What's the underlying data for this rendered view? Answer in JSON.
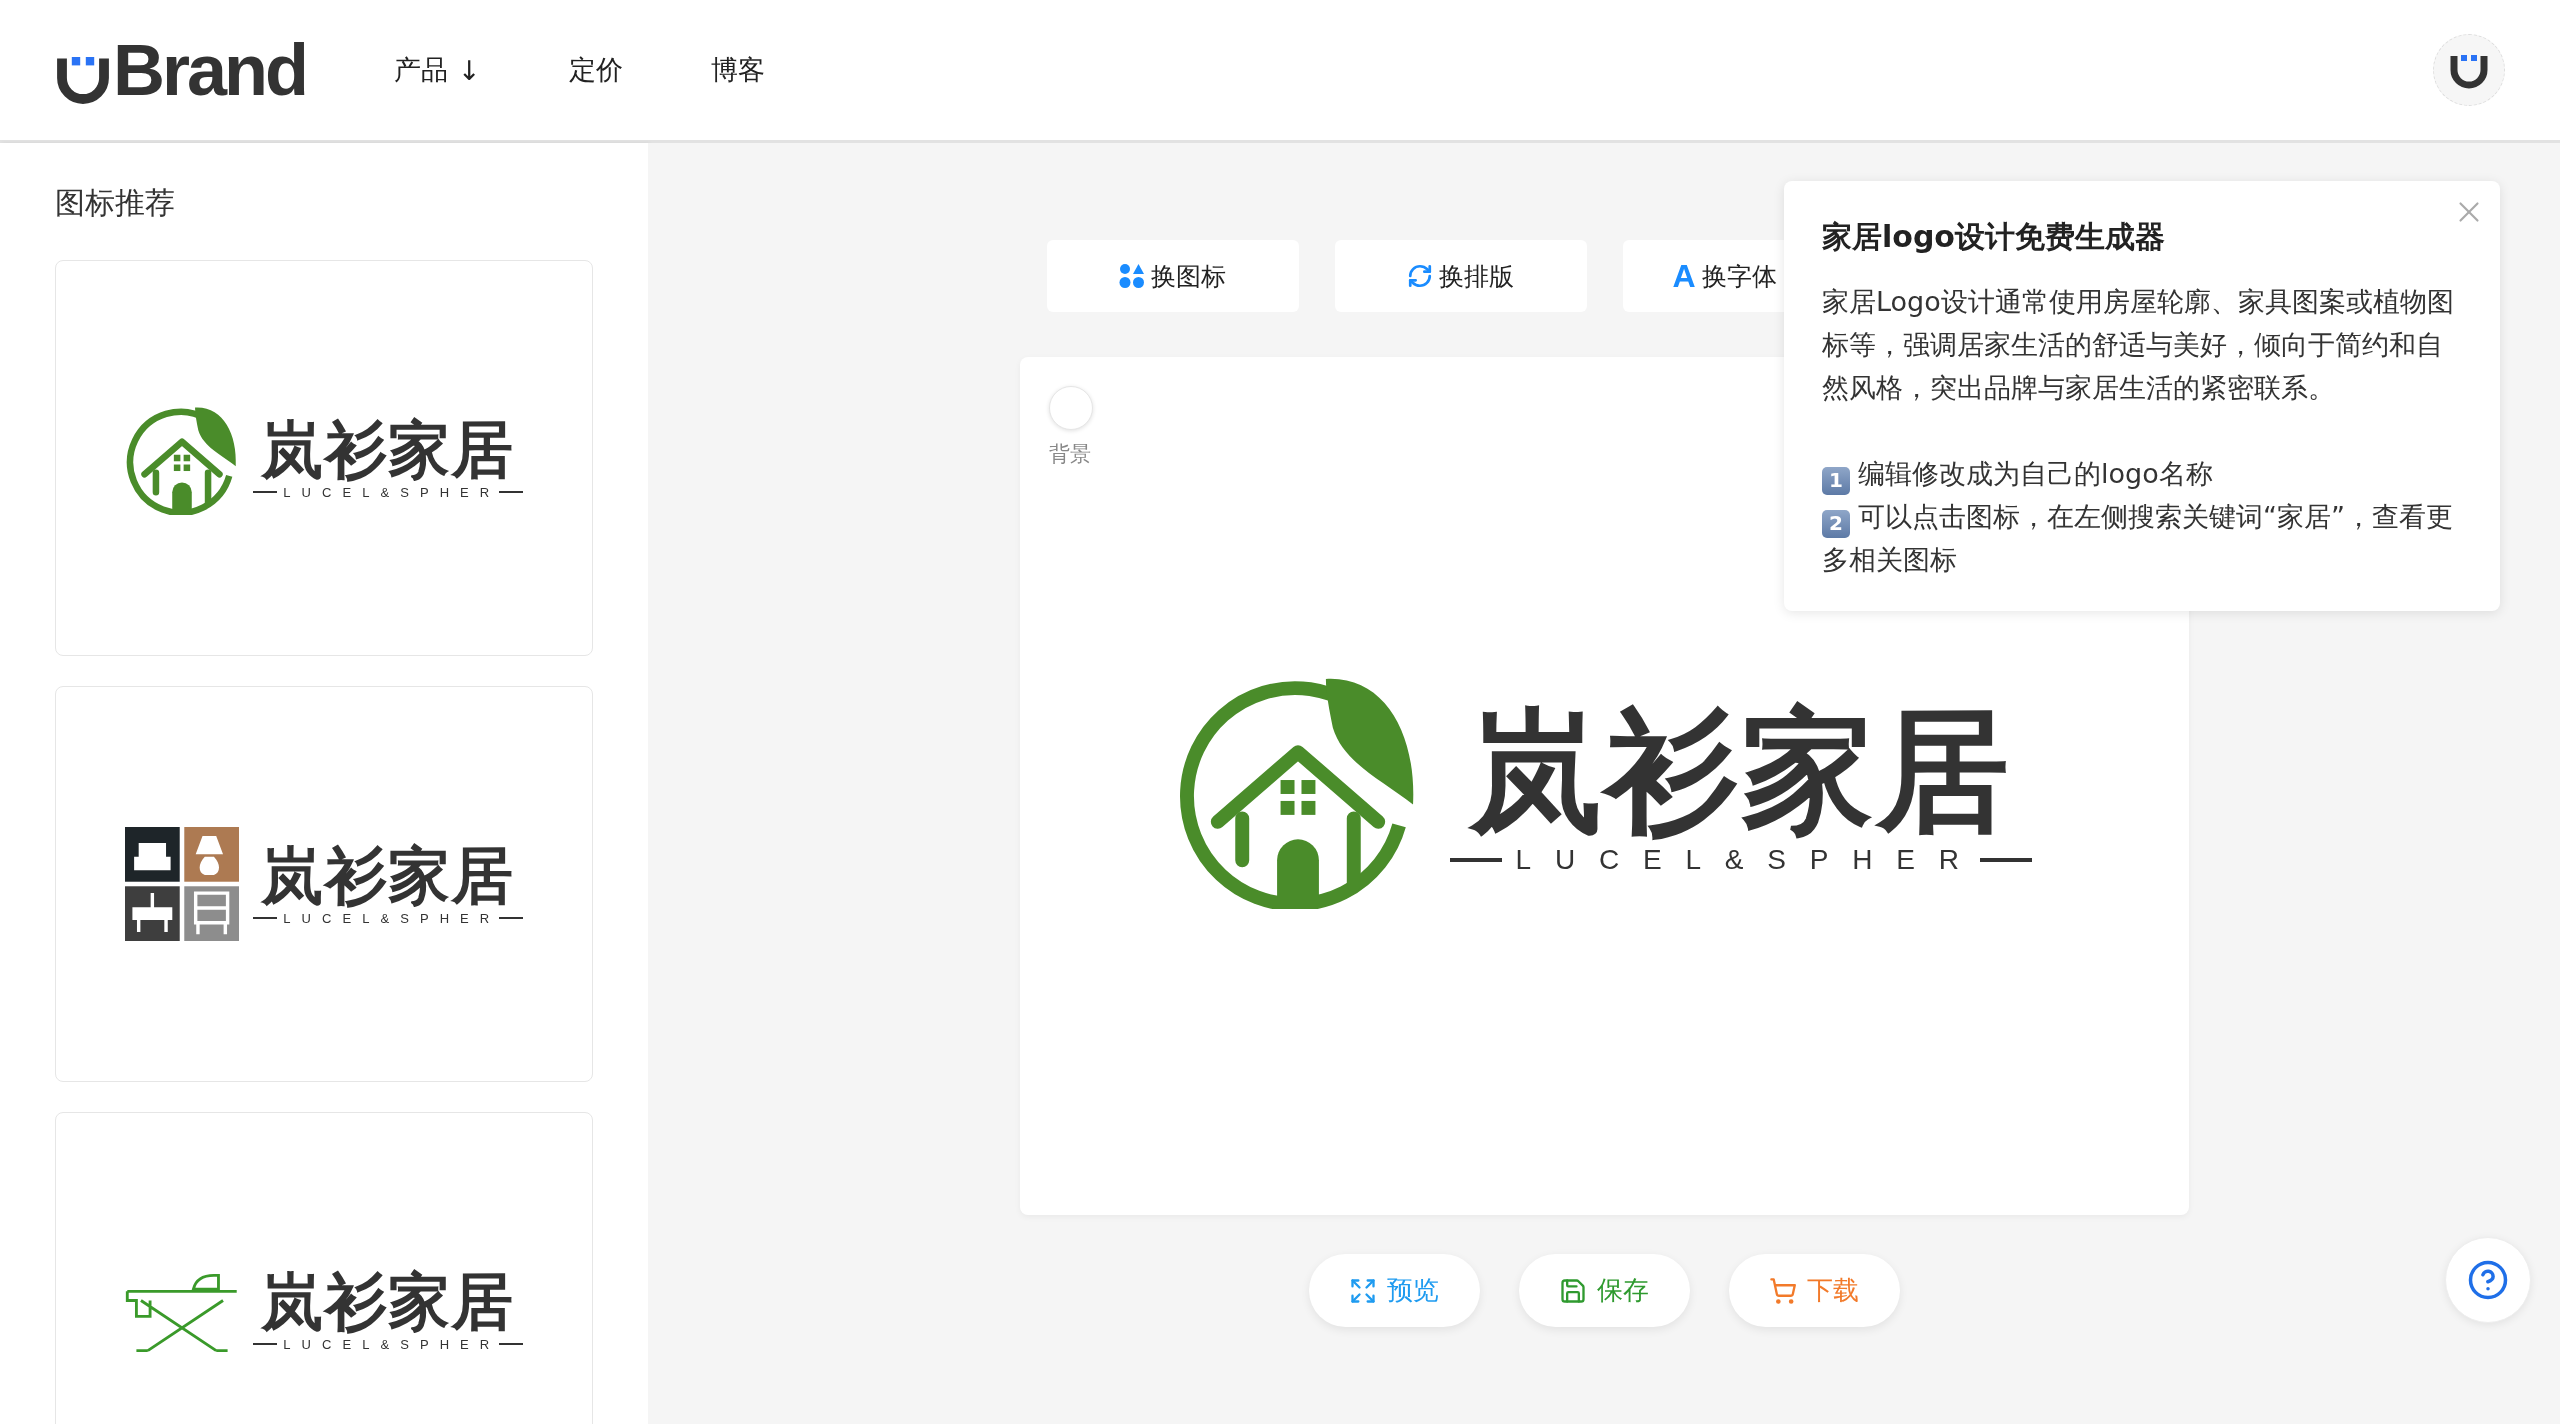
{
  "header": {
    "brand": "Brand",
    "nav": [
      {
        "label": "产品",
        "kind": "dropdown",
        "indicator": "↓"
      },
      {
        "label": "定价",
        "kind": "link"
      },
      {
        "label": "博客",
        "kind": "link"
      }
    ]
  },
  "sidebar": {
    "title": "图标推荐",
    "cards": [
      {
        "kind": "house-leaf",
        "name": "岚衫家居",
        "tagline": "LUCEL&SPHER"
      },
      {
        "kind": "furniture",
        "name": "岚衫家居",
        "tagline": "LUCEL&SPHER"
      },
      {
        "kind": "ironing-board",
        "name": "岚衫家居",
        "tagline": "LUCEL&SPHER"
      }
    ]
  },
  "toolbar": [
    {
      "label": "换图标",
      "kind": "icons"
    },
    {
      "label": "换排版",
      "kind": "layout"
    },
    {
      "label": "换字体",
      "kind": "font",
      "glyph": "A"
    }
  ],
  "canvas": {
    "background_label": "背景",
    "logo": {
      "kind": "house-leaf",
      "name": "岚衫家居",
      "tagline": "LUCEL&SPHER"
    }
  },
  "tip": {
    "title": "家居logo设计免费生成器",
    "body": "家居Logo设计通常使用房屋轮廓、家具图案或植物图标等，强调居家生活的舒适与美好，倾向于简约和自然风格，突出品牌与家居生活的紧密联系。",
    "steps": [
      {
        "badge": "1",
        "text": "编辑修改成为自己的logo名称"
      },
      {
        "badge": "2",
        "text": "可以点击图标，在左侧搜索关键词“家居”，查看更多相关图标"
      }
    ]
  },
  "actions": [
    {
      "label": "预览",
      "kind": "preview"
    },
    {
      "label": "保存",
      "kind": "save"
    },
    {
      "label": "下载",
      "kind": "download"
    }
  ]
}
